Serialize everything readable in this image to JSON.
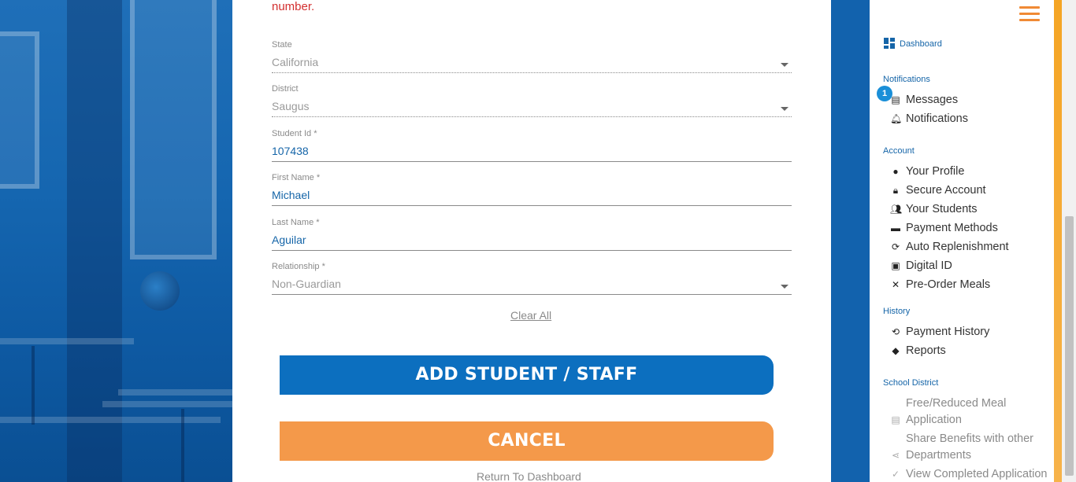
{
  "form": {
    "error_text": "number.",
    "state": {
      "label": "State",
      "value": "California"
    },
    "district": {
      "label": "District",
      "value": "Saugus"
    },
    "student_id": {
      "label": "Student Id *",
      "value": "107438"
    },
    "first_name": {
      "label": "First Name *",
      "value": "Michael"
    },
    "last_name": {
      "label": "Last Name *",
      "value": "Aguilar"
    },
    "relationship": {
      "label": "Relationship *",
      "value": "Non-Guardian"
    },
    "clear_all": "Clear All",
    "add_button": "ADD STUDENT / STAFF",
    "cancel_button": "CANCEL",
    "return_link": "Return To Dashboard"
  },
  "sidebar": {
    "dashboard": "Dashboard",
    "notifications_header": "Notifications",
    "messages": "Messages",
    "messages_badge": "1",
    "notifications": "Notifications",
    "account_header": "Account",
    "account_items": [
      "Your Profile",
      "Secure Account",
      "Your Students",
      "Payment Methods",
      "Auto Replenishment",
      "Digital ID",
      "Pre-Order Meals"
    ],
    "history_header": "History",
    "history_items": [
      "Payment History",
      "Reports"
    ],
    "district_header": "School District",
    "district_items": [
      "Free/Reduced Meal",
      "Application",
      "Share Benefits with other",
      "Departments",
      "View Completed Application"
    ]
  },
  "colors": {
    "primary": "#0c6fbf",
    "accent": "#f4994a",
    "error": "#d32f2f",
    "link": "#1565a8"
  }
}
